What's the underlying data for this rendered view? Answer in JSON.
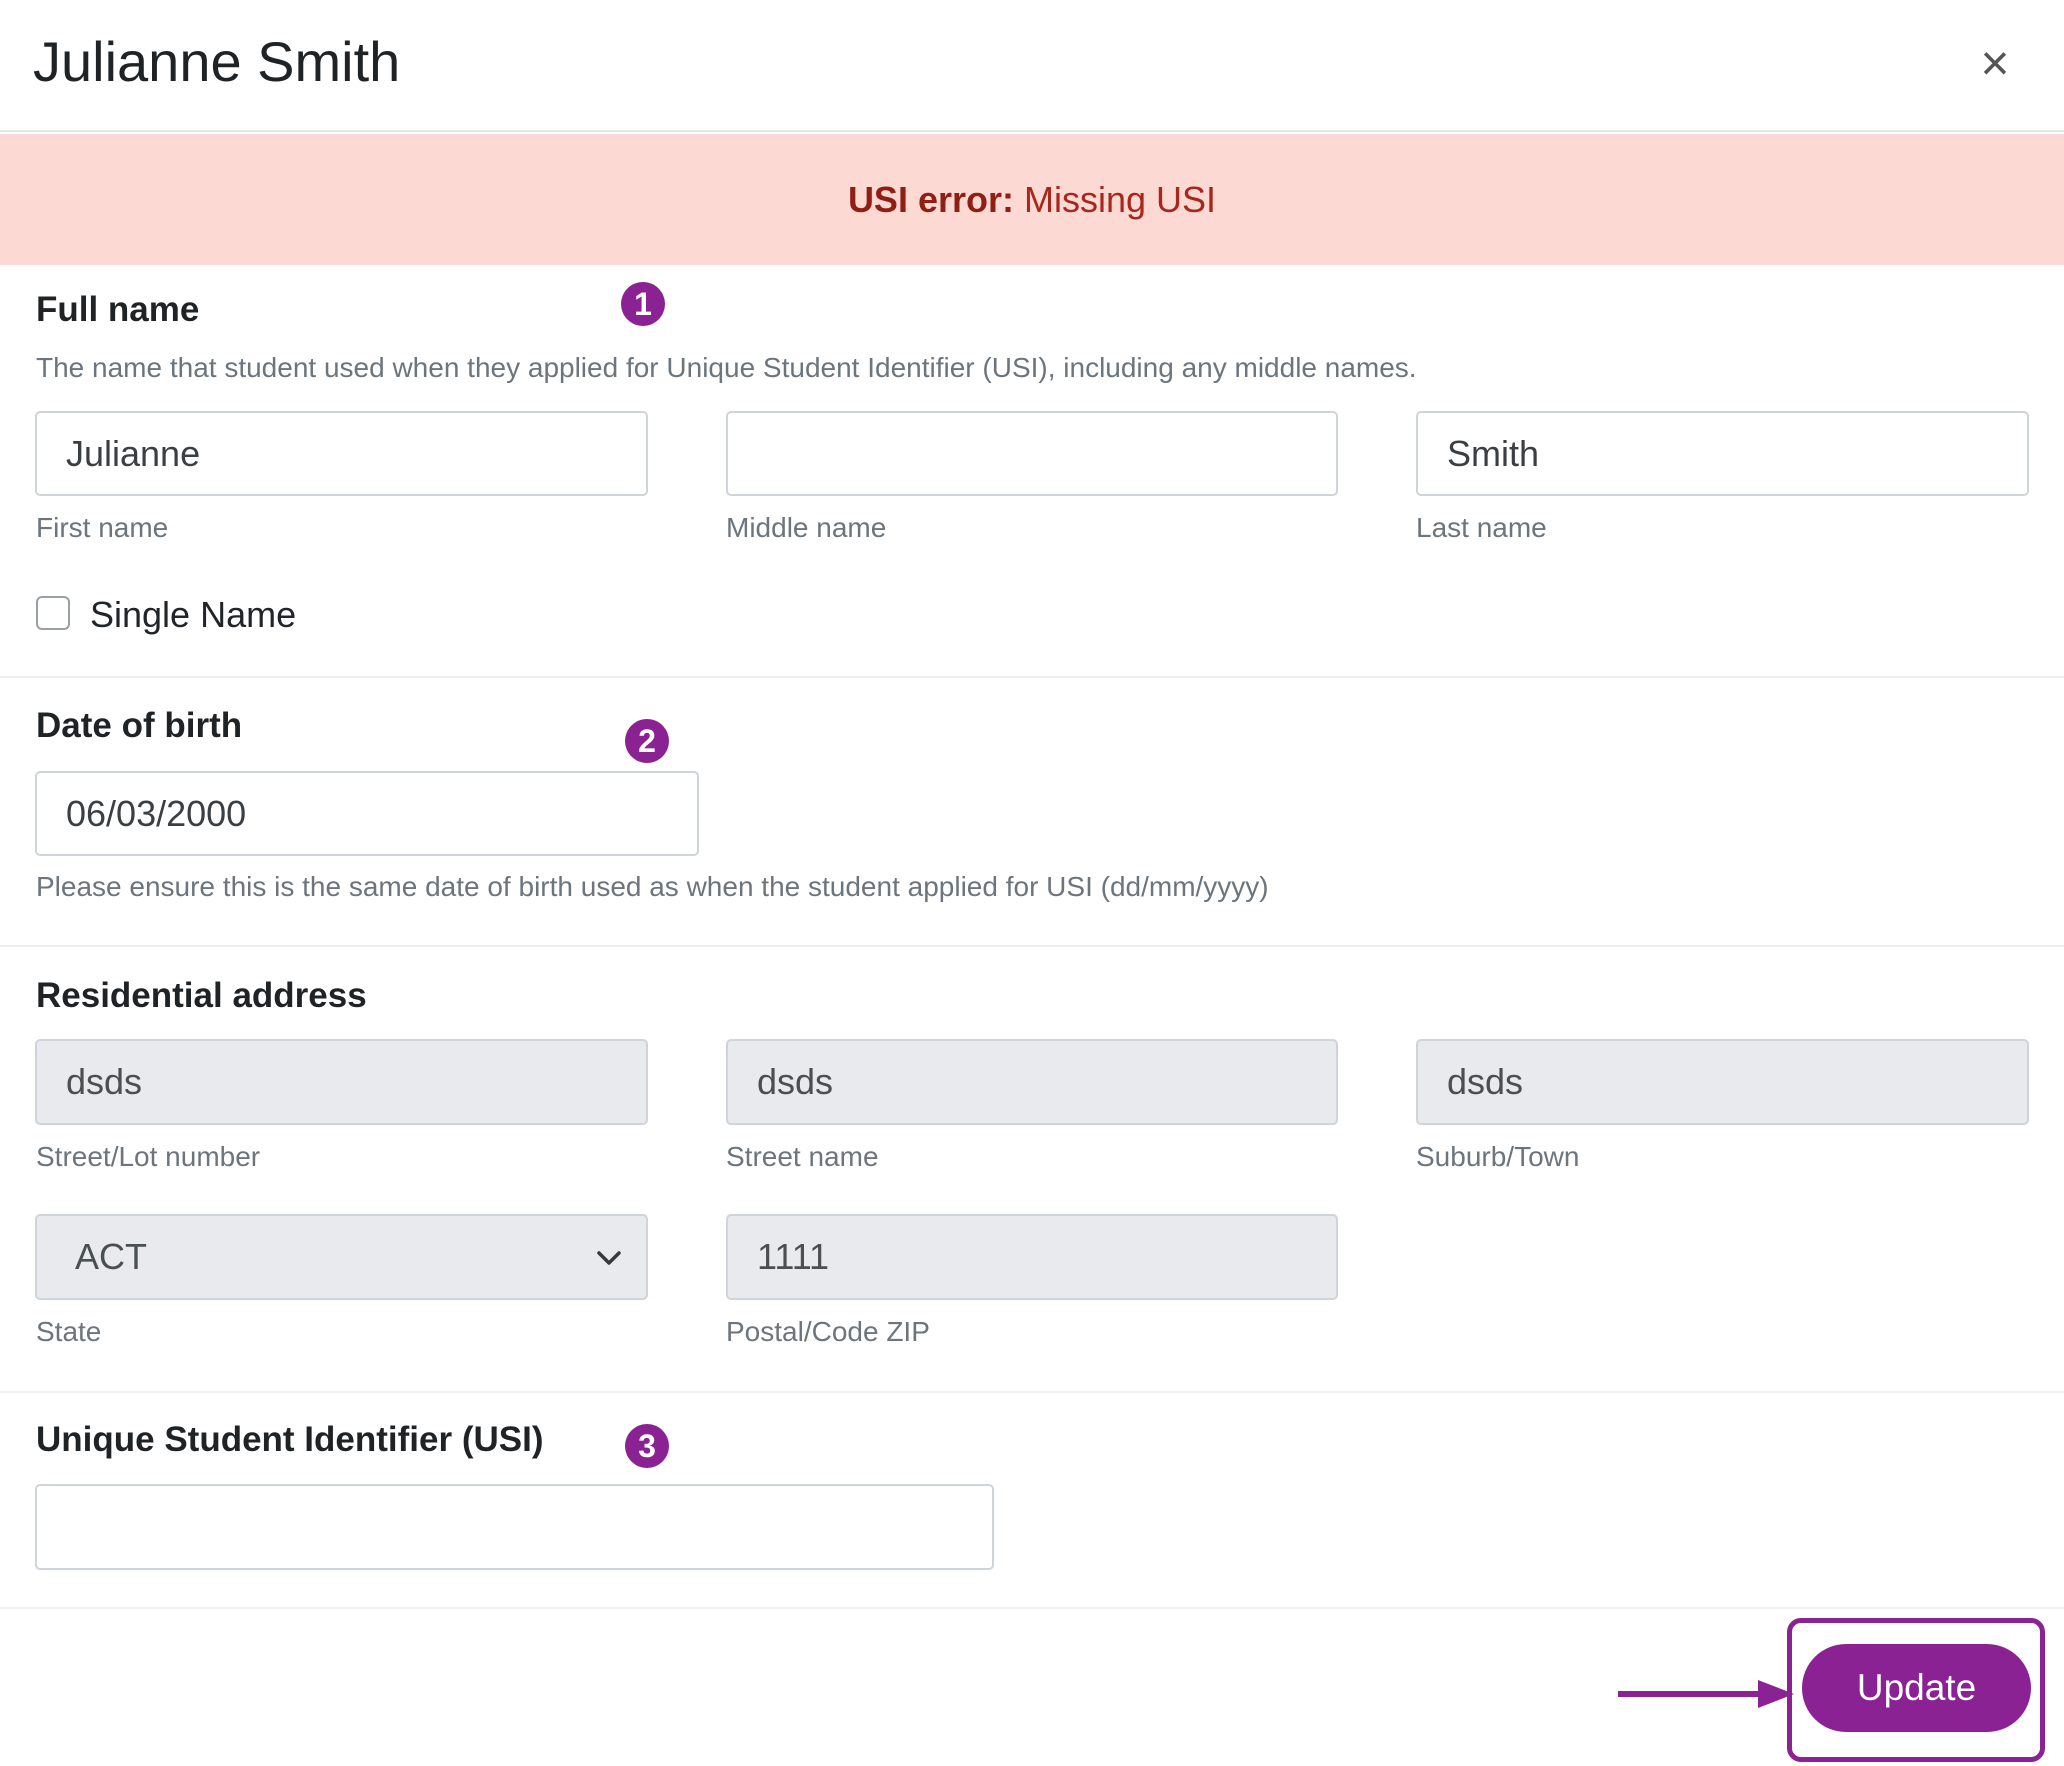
{
  "header": {
    "title": "Julianne Smith",
    "close_label": "×"
  },
  "error": {
    "label": "USI error:",
    "message": "Missing USI"
  },
  "full_name": {
    "title": "Full name",
    "badge": "1",
    "help": "The name that student used when they applied for Unique Student Identifier (USI), including any middle names.",
    "first_name": {
      "value": "Julianne",
      "label": "First name"
    },
    "middle_name": {
      "value": "",
      "label": "Middle name"
    },
    "last_name": {
      "value": "Smith",
      "label": "Last name"
    },
    "single_name_label": "Single Name"
  },
  "dob": {
    "title": "Date of birth",
    "badge": "2",
    "value": "06/03/2000",
    "help": "Please ensure this is the same date of birth used as when the student applied for USI (dd/mm/yyyy)"
  },
  "address": {
    "title": "Residential address",
    "street_number": {
      "value": "dsds",
      "label": "Street/Lot number"
    },
    "street_name": {
      "value": "dsds",
      "label": "Street name"
    },
    "suburb": {
      "value": "dsds",
      "label": "Suburb/Town"
    },
    "state": {
      "value": "ACT",
      "label": "State"
    },
    "postcode": {
      "value": "1111",
      "label": "Postal/Code ZIP"
    }
  },
  "usi": {
    "title": "Unique Student Identifier (USI)",
    "badge": "3",
    "value": ""
  },
  "footer": {
    "update_label": "Update"
  },
  "colors": {
    "accent": "#8a2293",
    "error_bg": "#fdd9d4",
    "error_text": "#a8261b"
  }
}
